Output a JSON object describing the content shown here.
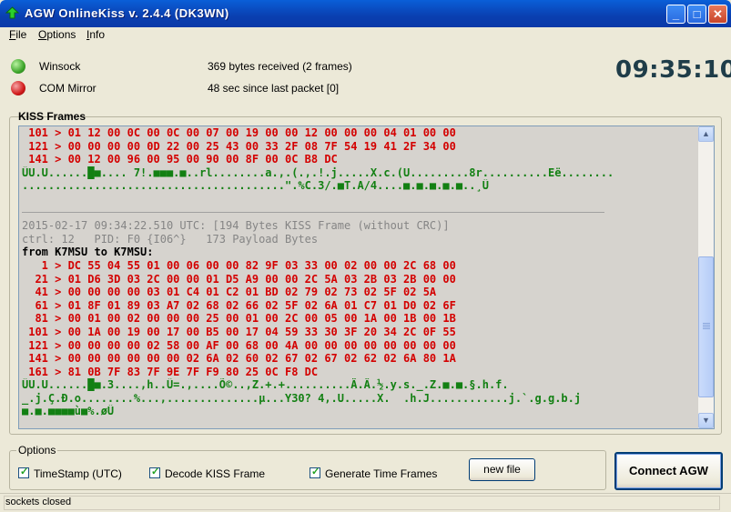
{
  "window": {
    "title": "AGW OnlineKiss v. 2.4.4  (DK3WN)",
    "buttons": [
      "_",
      "□",
      "✕"
    ]
  },
  "menu": {
    "file": "File",
    "options": "Options",
    "info": "Info"
  },
  "status": {
    "winsock_label": "Winsock",
    "winsock_value": "369 bytes received (2 frames)",
    "com_label": "COM Mirror",
    "com_value": "48 sec since last packet [0]",
    "clock": "09:35:10",
    "winsock_color": "#3da52a",
    "com_color": "#d11a1a"
  },
  "kiss": {
    "label": "KISS Frames",
    "lines": [
      {
        "cls": "hex",
        "text": " 101 > 01 12 00 0C 00 0C 00 07 00 19 00 00 12 00 00 00 04 01 00 00"
      },
      {
        "cls": "hex",
        "text": " 121 > 00 00 00 00 0D 22 00 25 43 00 33 2F 08 7F 54 19 41 2F 34 00"
      },
      {
        "cls": "hex",
        "text": " 141 > 00 12 00 96 00 95 00 90 00 8F 00 0C B8 DC"
      },
      {
        "cls": "ascii",
        "text": "ÜU.U......█■.... 7!.■■■.■..rl........a.,.(.,.!.j.....X.c.(U.........8r..........Eë........"
      },
      {
        "cls": "ascii",
        "text": "........................................\".%C.3/.■T.A/4....■.■.■.■.■..¸Ü"
      },
      {
        "cls": "blank",
        "text": ""
      },
      {
        "cls": "sep",
        "text": ""
      },
      {
        "cls": "meta",
        "text": "2015-02-17 09:34:22.510 UTC: [194 Bytes KISS Frame (without CRC)]"
      },
      {
        "cls": "meta",
        "text": "ctrl: 12   PID: F0 {I06^}   173 Payload Bytes"
      },
      {
        "cls": "from",
        "text": "from K7MSU to K7MSU:"
      },
      {
        "cls": "hex",
        "text": "   1 > DC 55 04 55 01 00 06 00 00 82 9F 03 33 00 02 00 00 2C 68 00"
      },
      {
        "cls": "hex",
        "text": "  21 > 01 D6 3D 03 2C 00 00 01 D5 A9 00 00 2C 5A 03 2B 03 2B 00 00"
      },
      {
        "cls": "hex",
        "text": "  41 > 00 00 00 00 03 01 C4 01 C2 01 BD 02 79 02 73 02 5F 02 5A"
      },
      {
        "cls": "hex",
        "text": "  61 > 01 8F 01 89 03 A7 02 68 02 66 02 5F 02 6A 01 C7 01 D0 02 6F"
      },
      {
        "cls": "hex",
        "text": "  81 > 00 01 00 02 00 00 00 25 00 01 00 2C 00 05 00 1A 00 1B 00 1B"
      },
      {
        "cls": "hex",
        "text": " 101 > 00 1A 00 19 00 17 00 B5 00 17 04 59 33 30 3F 20 34 2C 0F 55"
      },
      {
        "cls": "hex",
        "text": " 121 > 00 00 00 00 02 58 00 AF 00 68 00 4A 00 00 00 00 00 00 00 00"
      },
      {
        "cls": "hex",
        "text": " 141 > 00 00 00 00 00 00 02 6A 02 60 02 67 02 67 02 62 02 6A 80 1A"
      },
      {
        "cls": "hex",
        "text": " 161 > 81 0B 7F 83 7F 9E 7F F9 80 25 0C F8 DC"
      },
      {
        "cls": "ascii",
        "text": "ÜU.U......█■.3....,h..Ü=.,....Õ©..,Z.+.+..........Ä.Â.½.y.s._.Z.■.■.§.h.f."
      },
      {
        "cls": "ascii",
        "text": "_.j.Ç.Ð.o........%...,..............µ...Y30? 4,.U.....X.  .h.J............j.`.g.g.b.j"
      },
      {
        "cls": "ascii",
        "text": "■.■.■■■■ù■%.øÜ"
      }
    ]
  },
  "options": {
    "label": "Options",
    "timestamp": "TimeStamp (UTC)",
    "decode": "Decode KISS Frame",
    "generate": "Generate Time Frames",
    "new_file": "new file",
    "connect": "Connect AGW"
  },
  "statusbar": {
    "text": "sockets closed"
  }
}
